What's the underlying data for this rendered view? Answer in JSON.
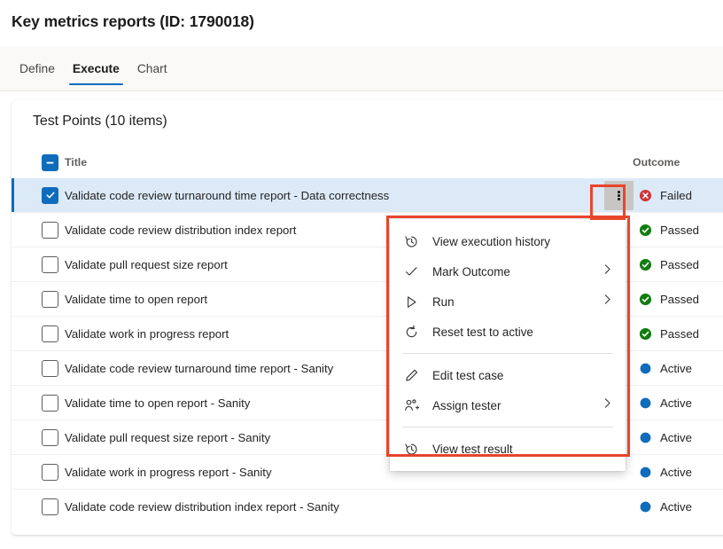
{
  "header": {
    "title": "Key metrics reports (ID: 1790018)"
  },
  "tabs": [
    {
      "label": "Define",
      "active": false
    },
    {
      "label": "Execute",
      "active": true
    },
    {
      "label": "Chart",
      "active": false
    }
  ],
  "card": {
    "title": "Test Points (10 items)",
    "columns": {
      "select_all_state": "indeterminate",
      "title": "Title",
      "outcome": "Outcome"
    }
  },
  "rows": [
    {
      "title": "Validate code review turnaround time report - Data correctness",
      "outcome": "Failed",
      "status": "failed",
      "checked": true,
      "selected": true
    },
    {
      "title": "Validate code review distribution index report",
      "outcome": "Passed",
      "status": "passed",
      "checked": false,
      "selected": false
    },
    {
      "title": "Validate pull request size report",
      "outcome": "Passed",
      "status": "passed",
      "checked": false,
      "selected": false
    },
    {
      "title": "Validate time to open report",
      "outcome": "Passed",
      "status": "passed",
      "checked": false,
      "selected": false
    },
    {
      "title": "Validate work in progress report",
      "outcome": "Passed",
      "status": "passed",
      "checked": false,
      "selected": false
    },
    {
      "title": "Validate code review turnaround time report - Sanity",
      "outcome": "Active",
      "status": "active",
      "checked": false,
      "selected": false
    },
    {
      "title": "Validate time to open report - Sanity",
      "outcome": "Active",
      "status": "active",
      "checked": false,
      "selected": false
    },
    {
      "title": "Validate pull request size report - Sanity",
      "outcome": "Active",
      "status": "active",
      "checked": false,
      "selected": false
    },
    {
      "title": "Validate work in progress report - Sanity",
      "outcome": "Active",
      "status": "active",
      "checked": false,
      "selected": false
    },
    {
      "title": "Validate code review distribution index report - Sanity",
      "outcome": "Active",
      "status": "active",
      "checked": false,
      "selected": false
    }
  ],
  "context_menu": {
    "items": [
      {
        "label": "View execution history",
        "icon": "history-icon",
        "submenu": false,
        "type": "item"
      },
      {
        "label": "Mark Outcome",
        "icon": "checkmark-icon",
        "submenu": true,
        "type": "item"
      },
      {
        "label": "Run",
        "icon": "play-icon",
        "submenu": true,
        "type": "item"
      },
      {
        "label": "Reset test to active",
        "icon": "refresh-icon",
        "submenu": false,
        "type": "item"
      },
      {
        "type": "separator"
      },
      {
        "label": "Edit test case",
        "icon": "pencil-icon",
        "submenu": false,
        "type": "item"
      },
      {
        "label": "Assign tester",
        "icon": "assign-person-icon",
        "submenu": true,
        "type": "item"
      },
      {
        "type": "separator"
      },
      {
        "label": "View test result",
        "icon": "history-icon",
        "submenu": false,
        "type": "item"
      }
    ]
  },
  "kebab": {
    "label": "more-actions"
  },
  "colors": {
    "accent": "#0f6cbd",
    "failed": "#d13438",
    "passed": "#107c10",
    "active": "#0f6cbd",
    "annotation": "#e8452b",
    "selected_row": "#dceaf7",
    "tab_strip": "#faf9f8"
  }
}
